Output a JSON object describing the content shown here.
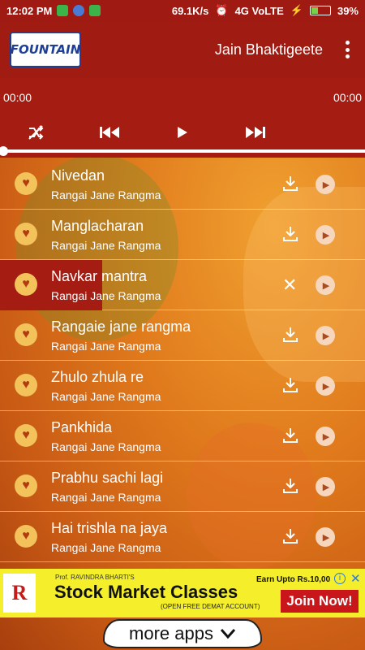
{
  "status_bar": {
    "time": "12:02 PM",
    "speed": "69.1K/s",
    "network": "4G VoLTE",
    "battery": "39%",
    "battery_level": 0.39
  },
  "app_bar": {
    "logo_text": "FOUNTAIN",
    "title": "Jain Bhaktigeete"
  },
  "player": {
    "current_time": "00:00",
    "total_time": "00:00",
    "progress": 0
  },
  "tracks": [
    {
      "title": "Nivedan",
      "artist": "Rangai Jane Rangma",
      "state": "download"
    },
    {
      "title": "Manglacharan",
      "artist": "Rangai Jane Rangma",
      "state": "download"
    },
    {
      "title": "Navkar mantra",
      "artist": "Rangai Jane Rangma",
      "state": "active"
    },
    {
      "title": "Rangaie jane rangma",
      "artist": "Rangai Jane Rangma",
      "state": "download"
    },
    {
      "title": "Zhulo zhula re",
      "artist": "Rangai Jane Rangma",
      "state": "download"
    },
    {
      "title": "Pankhida",
      "artist": "Rangai Jane Rangma",
      "state": "download"
    },
    {
      "title": "Prabhu sachi lagi",
      "artist": "Rangai Jane Rangma",
      "state": "download"
    },
    {
      "title": "Hai trishla na jaya",
      "artist": "Rangai Jane Rangma",
      "state": "download"
    }
  ],
  "ad": {
    "logo_letter": "R",
    "presenter": "Prof. RAVINDRA BHARTI'S",
    "headline": "Stock Market Classes",
    "subline": "(OPEN FREE DEMAT ACCOUNT)",
    "earn": "Earn Upto Rs.10,00",
    "cta": "Join Now!"
  },
  "footer": {
    "more_apps": "more apps"
  },
  "colors": {
    "primary": "#a01c12",
    "heart_bg": "#f3c25a",
    "ad_bg": "#f4ef2a",
    "ad_cta": "#c8161b"
  }
}
